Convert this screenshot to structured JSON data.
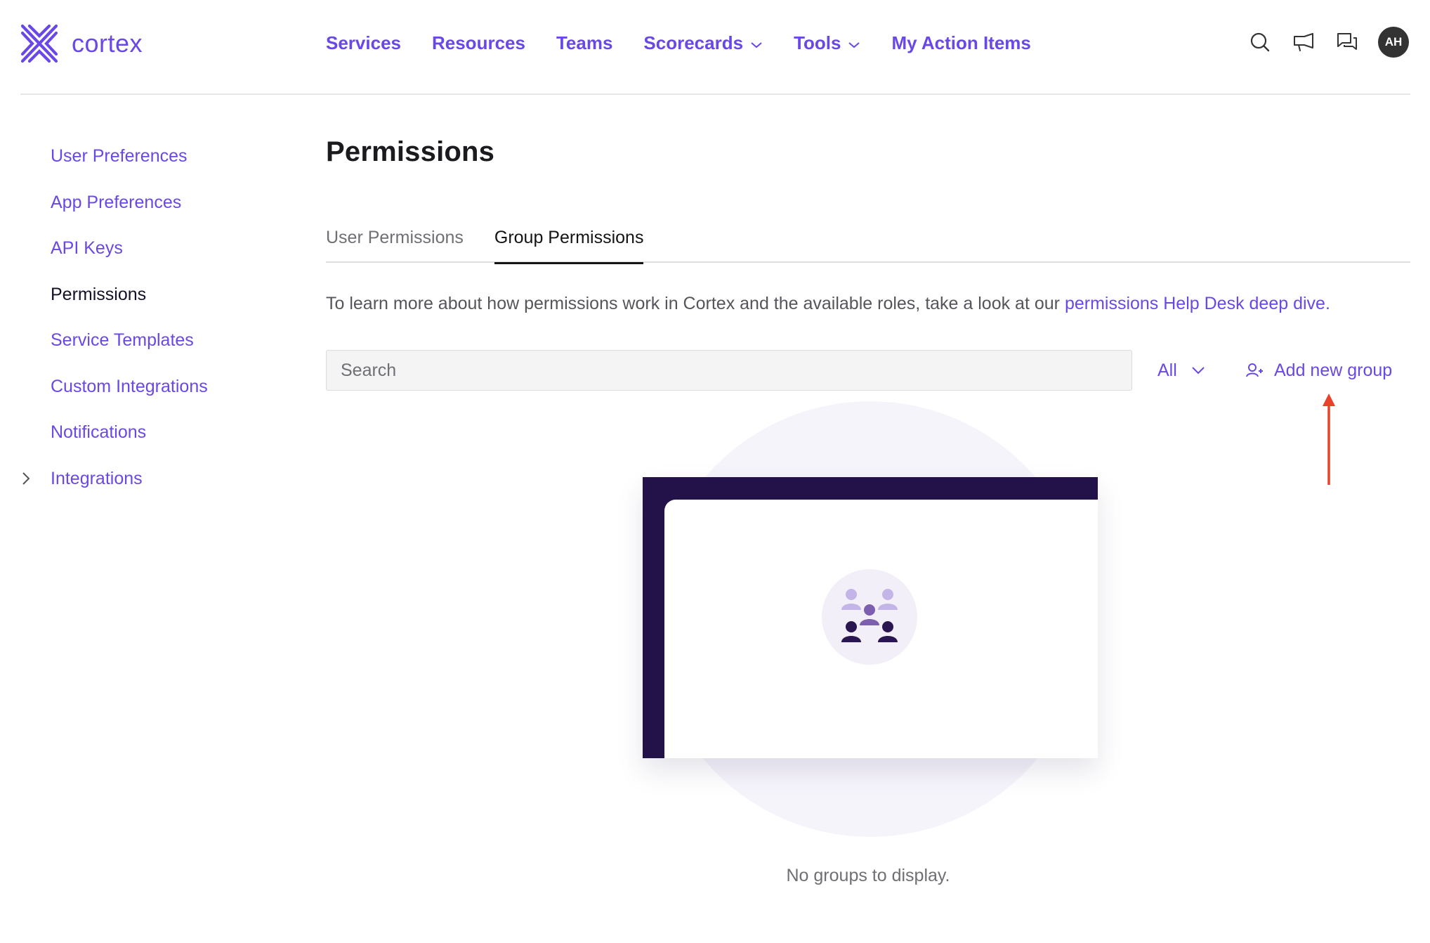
{
  "brand": {
    "name": "cortex",
    "color": "#6a48e6",
    "logo_icon": "cortex-logo-icon"
  },
  "nav": {
    "items": [
      {
        "label": "Services",
        "has_dropdown": false
      },
      {
        "label": "Resources",
        "has_dropdown": false
      },
      {
        "label": "Teams",
        "has_dropdown": false
      },
      {
        "label": "Scorecards",
        "has_dropdown": true
      },
      {
        "label": "Tools",
        "has_dropdown": true
      },
      {
        "label": "My Action Items",
        "has_dropdown": false
      }
    ],
    "icons": [
      "search-icon",
      "announcement-icon",
      "chat-icon"
    ],
    "avatar_initials": "AH"
  },
  "sidebar": {
    "items": [
      {
        "label": "User Preferences",
        "active": false
      },
      {
        "label": "App Preferences",
        "active": false
      },
      {
        "label": "API Keys",
        "active": false
      },
      {
        "label": "Permissions",
        "active": true
      },
      {
        "label": "Service Templates",
        "active": false
      },
      {
        "label": "Custom Integrations",
        "active": false
      },
      {
        "label": "Notifications",
        "active": false
      },
      {
        "label": "Integrations",
        "active": false,
        "expandable": true
      }
    ]
  },
  "main": {
    "title": "Permissions",
    "tabs": [
      {
        "label": "User Permissions",
        "active": false
      },
      {
        "label": "Group Permissions",
        "active": true
      }
    ],
    "intro_text": "To learn more about how permissions work in Cortex and the available roles, take a look at our ",
    "intro_link": "permissions Help Desk deep dive.",
    "search": {
      "placeholder": "Search",
      "value": ""
    },
    "filter": {
      "selected": "All"
    },
    "add_button": {
      "label": "Add new group",
      "icon": "add-user-icon"
    },
    "annotation": {
      "color": "#e8412c",
      "points_to": "Add new group"
    },
    "empty_state": {
      "message": "No groups to display.",
      "icon": "group-people-icon"
    }
  }
}
